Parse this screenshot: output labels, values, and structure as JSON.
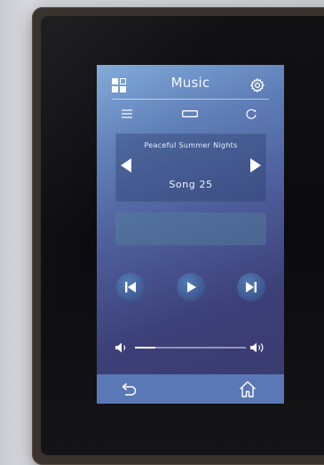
{
  "header": {
    "title": "Music",
    "grid_icon": "grid-icon",
    "settings_icon": "gear-icon"
  },
  "toolbar": {
    "menu_icon": "menu-icon",
    "queue_icon": "queue-icon",
    "repeat_icon": "repeat-icon"
  },
  "now_playing": {
    "station": "Peaceful Summer Nights",
    "song": "Song 25"
  },
  "transport": {
    "prev_icon": "skip-previous-icon",
    "play_icon": "play-icon",
    "next_icon": "skip-next-icon"
  },
  "volume": {
    "level": 0.18,
    "low_icon": "volume-low-icon",
    "high_icon": "volume-high-icon"
  },
  "footer": {
    "back_icon": "back-icon",
    "home_icon": "home-icon"
  },
  "colors": {
    "screen_top": "#7fa8d8",
    "screen_bottom": "#3a3a6e",
    "bottom_bar": "#5b78b6",
    "bezel": "#3a332d"
  }
}
